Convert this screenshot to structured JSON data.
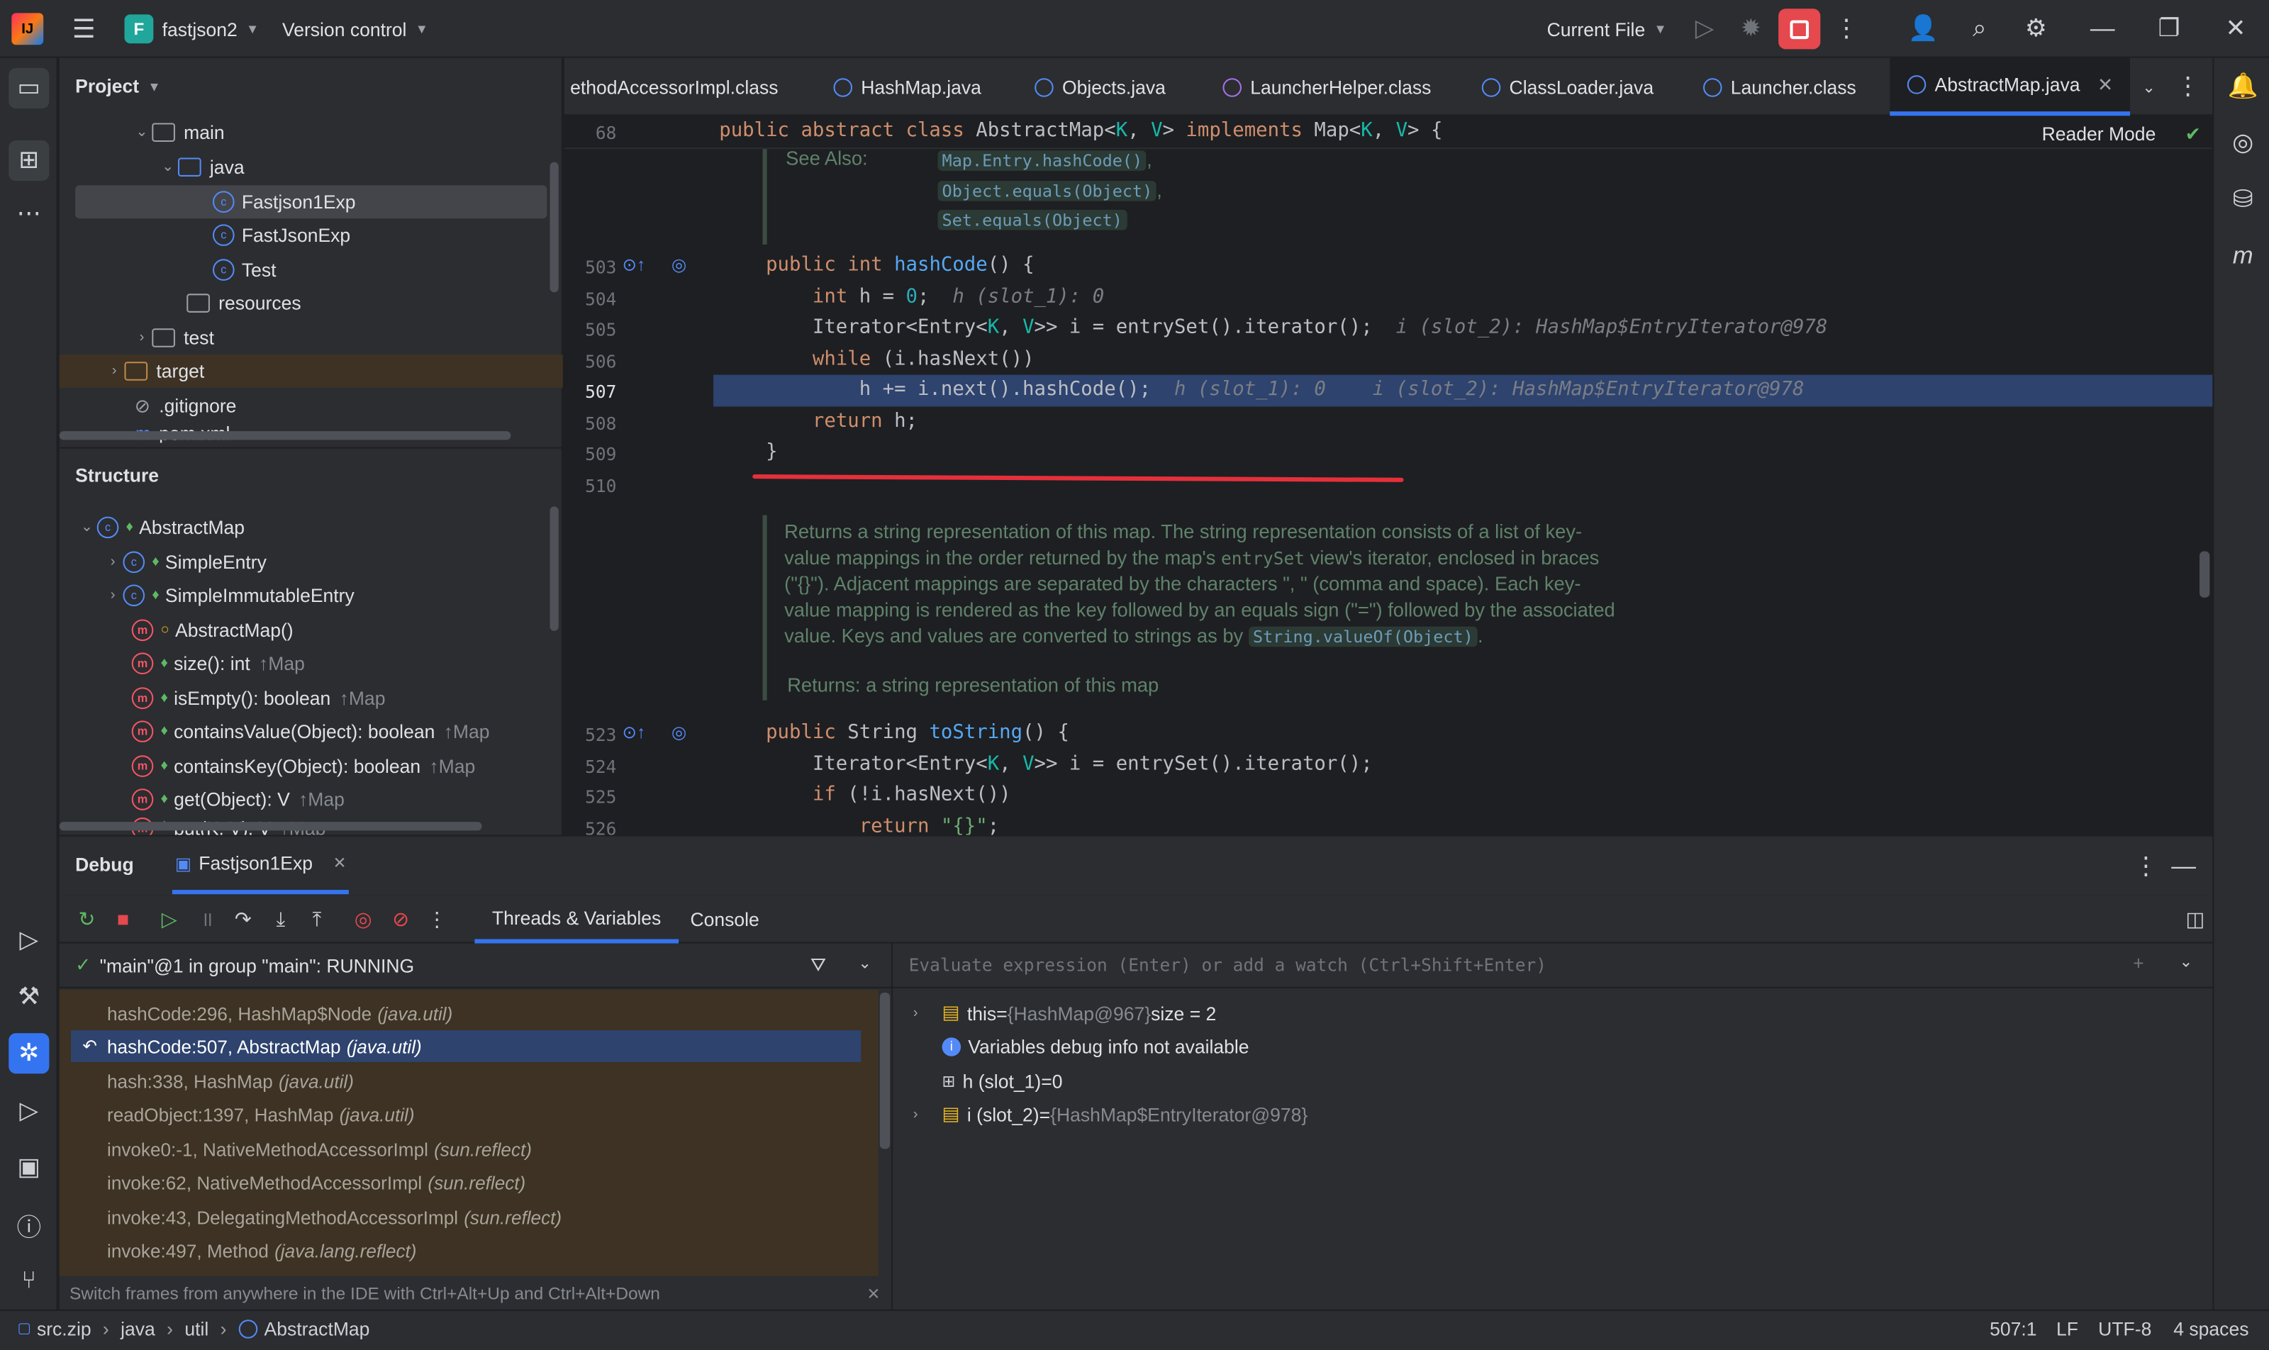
{
  "titlebar": {
    "project_badge": "F",
    "project_name": "fastjson2",
    "vcs": "Version control",
    "run_config": "Current File"
  },
  "project_panel": {
    "title": "Project",
    "items": [
      {
        "label": "main"
      },
      {
        "label": "java"
      },
      {
        "label": "Fastjson1Exp"
      },
      {
        "label": "FastJsonExp"
      },
      {
        "label": "Test"
      },
      {
        "label": "resources"
      },
      {
        "label": "test"
      },
      {
        "label": "target"
      },
      {
        "label": ".gitignore"
      },
      {
        "label": "pom.xml"
      }
    ]
  },
  "structure_panel": {
    "title": "Structure",
    "items": [
      {
        "label": "AbstractMap",
        "extra": ""
      },
      {
        "label": "SimpleEntry",
        "extra": ""
      },
      {
        "label": "SimpleImmutableEntry",
        "extra": ""
      },
      {
        "label": "AbstractMap()",
        "extra": ""
      },
      {
        "label": "size(): int",
        "extra": "↑Map"
      },
      {
        "label": "isEmpty(): boolean",
        "extra": "↑Map"
      },
      {
        "label": "containsValue(Object): boolean",
        "extra": "↑Map"
      },
      {
        "label": "containsKey(Object): boolean",
        "extra": "↑Map"
      },
      {
        "label": "get(Object): V",
        "extra": "↑Map"
      },
      {
        "label": "put(K, V): V",
        "extra": "↑Map"
      }
    ]
  },
  "tabs": [
    {
      "label": "ethodAccessorImpl.class"
    },
    {
      "label": "HashMap.java"
    },
    {
      "label": "Objects.java"
    },
    {
      "label": "LauncherHelper.class"
    },
    {
      "label": "ClassLoader.java"
    },
    {
      "label": "Launcher.class"
    },
    {
      "label": "AbstractMap.java"
    }
  ],
  "editor": {
    "reader_mode": "Reader Mode",
    "sticky_line": "68",
    "sticky_code": "public abstract class AbstractMap<K, V> implements Map<K, V> {",
    "see_also_label": "See Also:",
    "see_also": [
      "Map.Entry.hashCode()",
      "Object.equals(Object)",
      "Set.equals(Object)"
    ],
    "lines": [
      {
        "n": "503",
        "code": "public int hashCode() {"
      },
      {
        "n": "504",
        "code": "int h = 0;",
        "hint": "h (slot_1): 0"
      },
      {
        "n": "505",
        "code": "Iterator<Entry<K, V>> i = entrySet().iterator();",
        "hint": "i (slot_2): HashMap$EntryIterator@978"
      },
      {
        "n": "506",
        "code": "while (i.hasNext())"
      },
      {
        "n": "507",
        "code": "h += i.next().hashCode();",
        "hint": "h (slot_1): 0    i (slot_2): HashMap$EntryIterator@978"
      },
      {
        "n": "508",
        "code": "return h;"
      },
      {
        "n": "509",
        "code": "}"
      },
      {
        "n": "510",
        "code": ""
      }
    ],
    "doc": {
      "l1": "Returns a string representation of this map. The string representation consists of a list of key-",
      "l2a": "value mappings in the order returned by the map's ",
      "l2b": "entrySet",
      "l2c": " view's iterator, enclosed in braces",
      "l3": "(\"{}\"). Adjacent mappings are separated by the characters \", \" (comma and space). Each key-",
      "l4": "value mapping is rendered as the key followed by an equals sign (\"=\") followed by the associated",
      "l5a": "value. Keys and values are converted to strings as by ",
      "l5b": "String.valueOf(Object)",
      "l5c": ".",
      "returns": "Returns: a string representation of this map"
    },
    "lines2": [
      {
        "n": "523",
        "code": "public String toString() {"
      },
      {
        "n": "524",
        "code": "Iterator<Entry<K, V>> i = entrySet().iterator();"
      },
      {
        "n": "525",
        "code": "if (!i.hasNext())"
      },
      {
        "n": "526",
        "code": "return \"{}\";"
      }
    ]
  },
  "debug": {
    "title": "Debug",
    "session": "Fastjson1Exp",
    "tab_threads": "Threads & Variables",
    "tab_console": "Console",
    "thread": "\"main\"@1 in group \"main\": RUNNING",
    "frames": [
      {
        "m": "hashCode:296, HashMap$Node",
        "p": "(java.util)"
      },
      {
        "m": "hashCode:507, AbstractMap",
        "p": "(java.util)"
      },
      {
        "m": "hash:338, HashMap",
        "p": "(java.util)"
      },
      {
        "m": "readObject:1397, HashMap",
        "p": "(java.util)"
      },
      {
        "m": "invoke0:-1, NativeMethodAccessorImpl",
        "p": "(sun.reflect)"
      },
      {
        "m": "invoke:62, NativeMethodAccessorImpl",
        "p": "(sun.reflect)"
      },
      {
        "m": "invoke:43, DelegatingMethodAccessorImpl",
        "p": "(sun.reflect)"
      },
      {
        "m": "invoke:497, Method",
        "p": "(java.lang.reflect)"
      }
    ],
    "hint": "Switch frames from anywhere in the IDE with Ctrl+Alt+Up and Ctrl+Alt+Down",
    "eval_placeholder": "Evaluate expression (Enter) or add a watch (Ctrl+Shift+Enter)",
    "vars": [
      {
        "name": "this",
        "eq": " = ",
        "val": "{HashMap@967}",
        "extra": " size = 2"
      },
      {
        "name": "Variables debug info not available",
        "eq": "",
        "val": "",
        "extra": ""
      },
      {
        "name": "h (slot_1)",
        "eq": " = ",
        "val": "",
        "extra": "0"
      },
      {
        "name": "i (slot_2)",
        "eq": " = ",
        "val": "{HashMap$EntryIterator@978}",
        "extra": ""
      }
    ]
  },
  "status": {
    "crumbs": [
      "src.zip",
      "java",
      "util",
      "AbstractMap"
    ],
    "position": "507:1",
    "line_sep": "LF",
    "encoding": "UTF-8",
    "indent": "4 spaces"
  },
  "colors": {
    "accent": "#3574f0",
    "selection": "#2e436e",
    "underline": "#e5303b"
  }
}
